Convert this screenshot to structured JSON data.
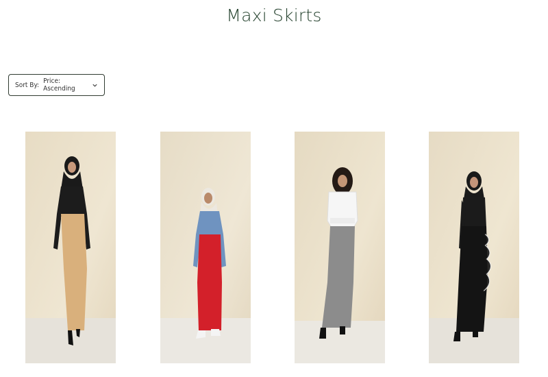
{
  "page": {
    "title": "Maxi Skirts"
  },
  "sort": {
    "label": "Sort By:",
    "value": "Price: Ascending",
    "icon": "chevron-down-icon"
  },
  "products": [
    {
      "image": "model in black hijab, black top and tan maxi skirt",
      "skirt_color": "#d9b07c",
      "top_color": "#1c1c1c"
    },
    {
      "image": "model in white hijab, denim jacket and red maxi skirt",
      "skirt_color": "#d3202a",
      "top_color": "#6f93c0"
    },
    {
      "image": "model in white shirt and grey maxi skirt",
      "skirt_color": "#8c8c8c",
      "top_color": "#f4f4f4"
    },
    {
      "image": "model in black hijab and black maxi skirt with white ruffle",
      "skirt_color": "#141414",
      "top_color": "#1b1b1b"
    }
  ]
}
